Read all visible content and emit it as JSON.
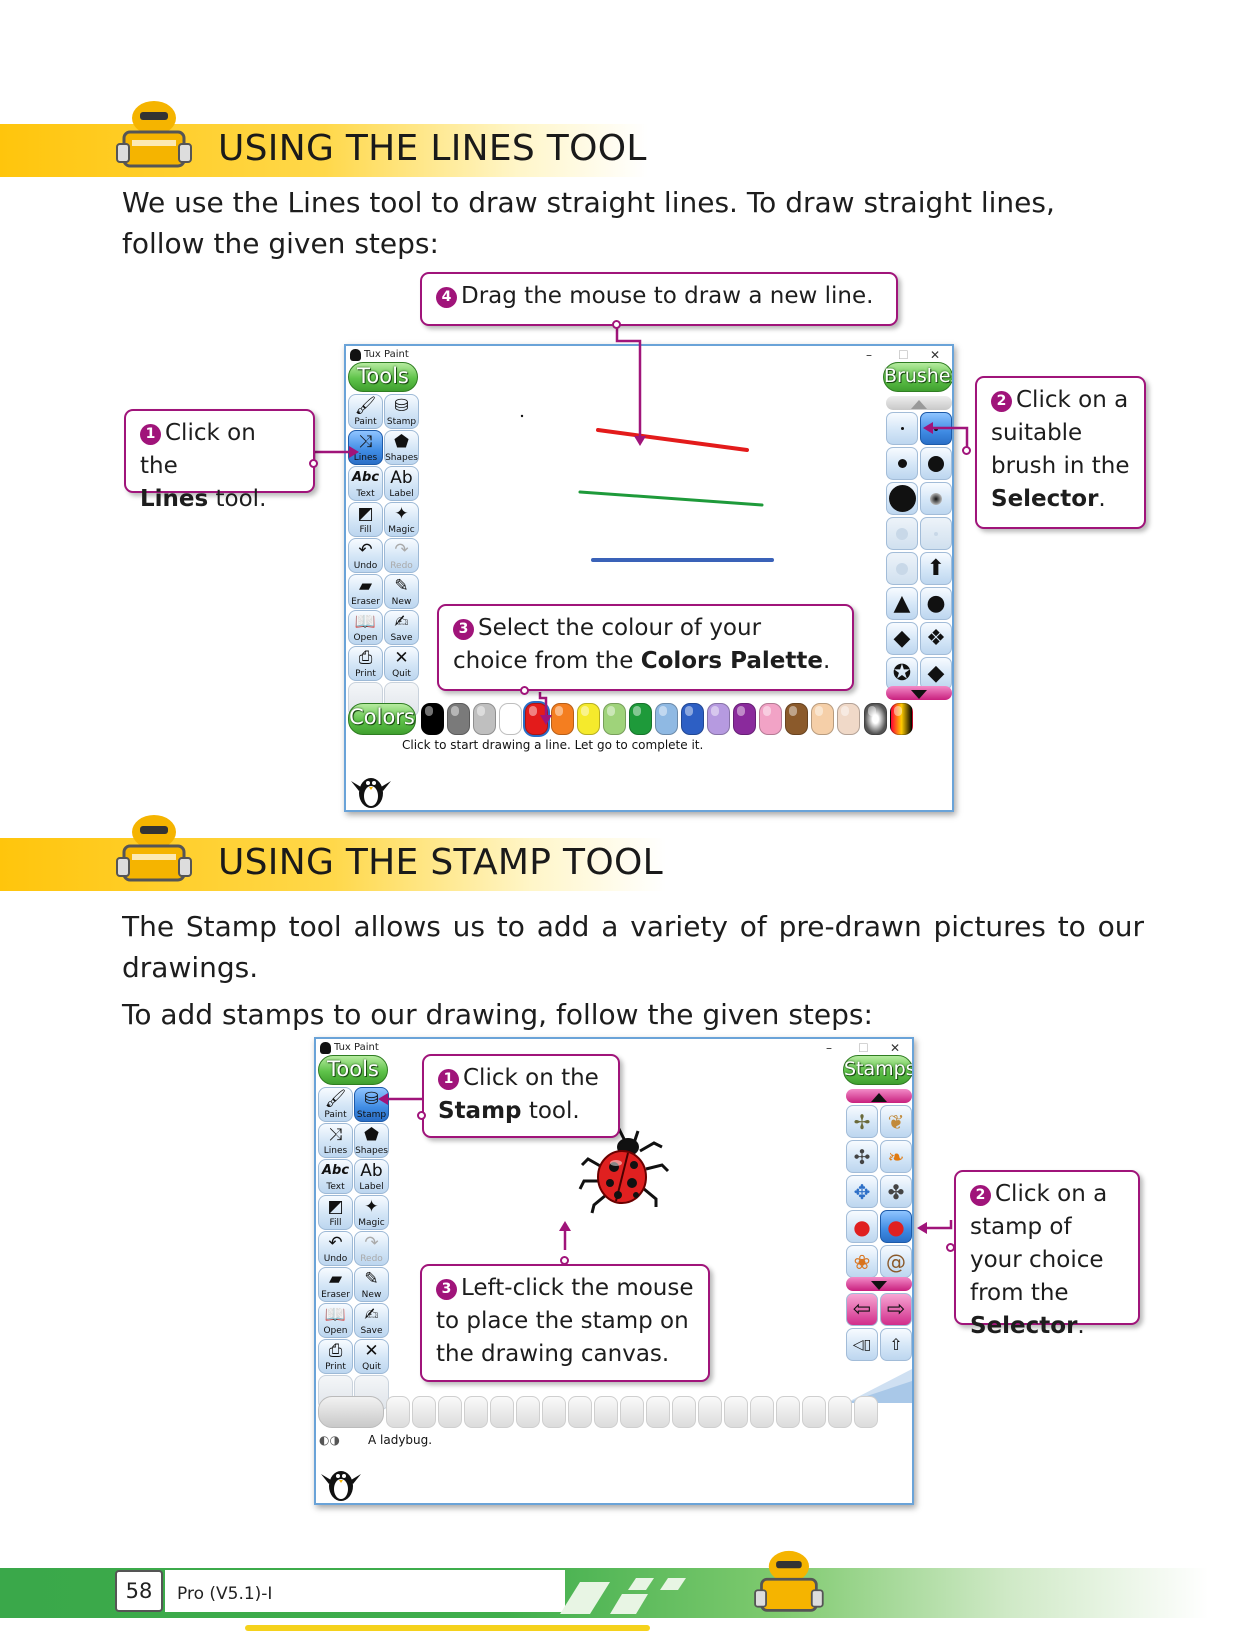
{
  "section1": {
    "title": "USING THE LINES TOOL",
    "intro": "We use the Lines tool to draw straight lines. To draw straight lines, follow the given steps:"
  },
  "lines_window": {
    "title": "Tux Paint",
    "controls": [
      "–",
      "☐",
      "✕"
    ],
    "tools_header": "Tools",
    "selector_header": "Brushes",
    "colors_header": "Colors",
    "status": "Click to start drawing a line. Let go to complete it.",
    "tools": [
      {
        "label": "Paint",
        "icon": "paintbrush-icon",
        "glyph": "🖌"
      },
      {
        "label": "Stamp",
        "icon": "stamp-icon",
        "glyph": "⛁"
      },
      {
        "label": "Lines",
        "icon": "lines-icon",
        "glyph": "⤨",
        "selected": true
      },
      {
        "label": "Shapes",
        "icon": "pentagon-icon",
        "glyph": "⬟"
      },
      {
        "label": "Text",
        "icon": "text-icon",
        "glyph": "Abc"
      },
      {
        "label": "Label",
        "icon": "label-icon",
        "glyph": "Ab"
      },
      {
        "label": "Fill",
        "icon": "bucket-icon",
        "glyph": "◩"
      },
      {
        "label": "Magic",
        "icon": "magic-wand-icon",
        "glyph": "✦"
      },
      {
        "label": "Undo",
        "icon": "undo-icon",
        "glyph": "↶"
      },
      {
        "label": "Redo",
        "icon": "redo-icon",
        "glyph": "↷",
        "disabled": true
      },
      {
        "label": "Eraser",
        "icon": "eraser-icon",
        "glyph": "▰"
      },
      {
        "label": "New",
        "icon": "new-page-icon",
        "glyph": "✎"
      },
      {
        "label": "Open",
        "icon": "open-book-icon",
        "glyph": "📖"
      },
      {
        "label": "Save",
        "icon": "save-icon",
        "glyph": "✍"
      },
      {
        "label": "Print",
        "icon": "printer-icon",
        "glyph": "⎙"
      },
      {
        "label": "Quit",
        "icon": "quit-icon",
        "glyph": "✕"
      }
    ],
    "palette": [
      "#000000",
      "#7a7a7a",
      "#bfbfbf",
      "#ffffff",
      "#e31b1b",
      "#f47e20",
      "#f5ea2c",
      "#9fd37a",
      "#1e9a3a",
      "#8fb9e3",
      "#2d5fc4",
      "#b69ae0",
      "#8a2a9c",
      "#f2a3c6",
      "#8b5a2b",
      "#f5cfa8",
      "#f0d9c8"
    ],
    "palette_selected_index": 4,
    "drawn_lines": [
      {
        "color": "#e31b1b"
      },
      {
        "color": "#1e9a3a"
      },
      {
        "color": "#3a62b8"
      }
    ]
  },
  "lines_callouts": {
    "c1": {
      "num": "1",
      "pre": "Click on the",
      "bold": "Lines",
      "post": "tool."
    },
    "c2": {
      "num": "2",
      "pre": "Click on a suitable brush in the",
      "bold": "Selector",
      "post": "."
    },
    "c3": {
      "num": "3",
      "pre": "Select the colour of your choice from the",
      "bold": "Colors Palette",
      "post": "."
    },
    "c4": {
      "num": "4",
      "text": "Drag the mouse to draw a new line."
    }
  },
  "section2": {
    "title": "USING THE STAMP TOOL",
    "intro": "The Stamp tool allows us to add a variety of pre-drawn pictures to our drawings.",
    "steps_intro": "To add stamps to our drawing, follow the given steps:"
  },
  "stamp_window": {
    "title": "Tux Paint",
    "controls": [
      "–",
      "☐",
      "✕"
    ],
    "tools_header": "Tools",
    "selector_header": "Stamps",
    "status": "A ladybug.",
    "stamps": [
      {
        "icon": "dragonfly-icon",
        "glyph": "✢"
      },
      {
        "icon": "moth-icon",
        "glyph": "❦"
      },
      {
        "icon": "mosquito-icon",
        "glyph": "✣"
      },
      {
        "icon": "butterfly-icon",
        "glyph": "❧"
      },
      {
        "icon": "dragonfly-blue-icon",
        "glyph": "✥"
      },
      {
        "icon": "fly-icon",
        "glyph": "✤"
      },
      {
        "icon": "ladybug-icon",
        "glyph": "●"
      },
      {
        "icon": "ladybug-icon",
        "glyph": "●",
        "selected": true
      },
      {
        "icon": "butterfly-orange-icon",
        "glyph": "❀"
      },
      {
        "icon": "snail-icon",
        "glyph": "@"
      }
    ]
  },
  "stamp_callouts": {
    "c1": {
      "num": "1",
      "pre": "Click on the",
      "bold": "Stamp",
      "post": "tool."
    },
    "c2": {
      "num": "2",
      "pre": "Click on a stamp of your choice from the",
      "bold": "Selector",
      "post": "."
    },
    "c3": {
      "num": "3",
      "text": "Left-click the mouse to place the stamp on the drawing canvas."
    }
  },
  "footer": {
    "page_number": "58",
    "book": "Pro (V5.1)-I"
  },
  "colors": {
    "accent_magenta": "#a0147a",
    "heading_yellow": "#ffc50c",
    "footer_green": "#3aa84a",
    "tux_green": "#5fc34a"
  }
}
